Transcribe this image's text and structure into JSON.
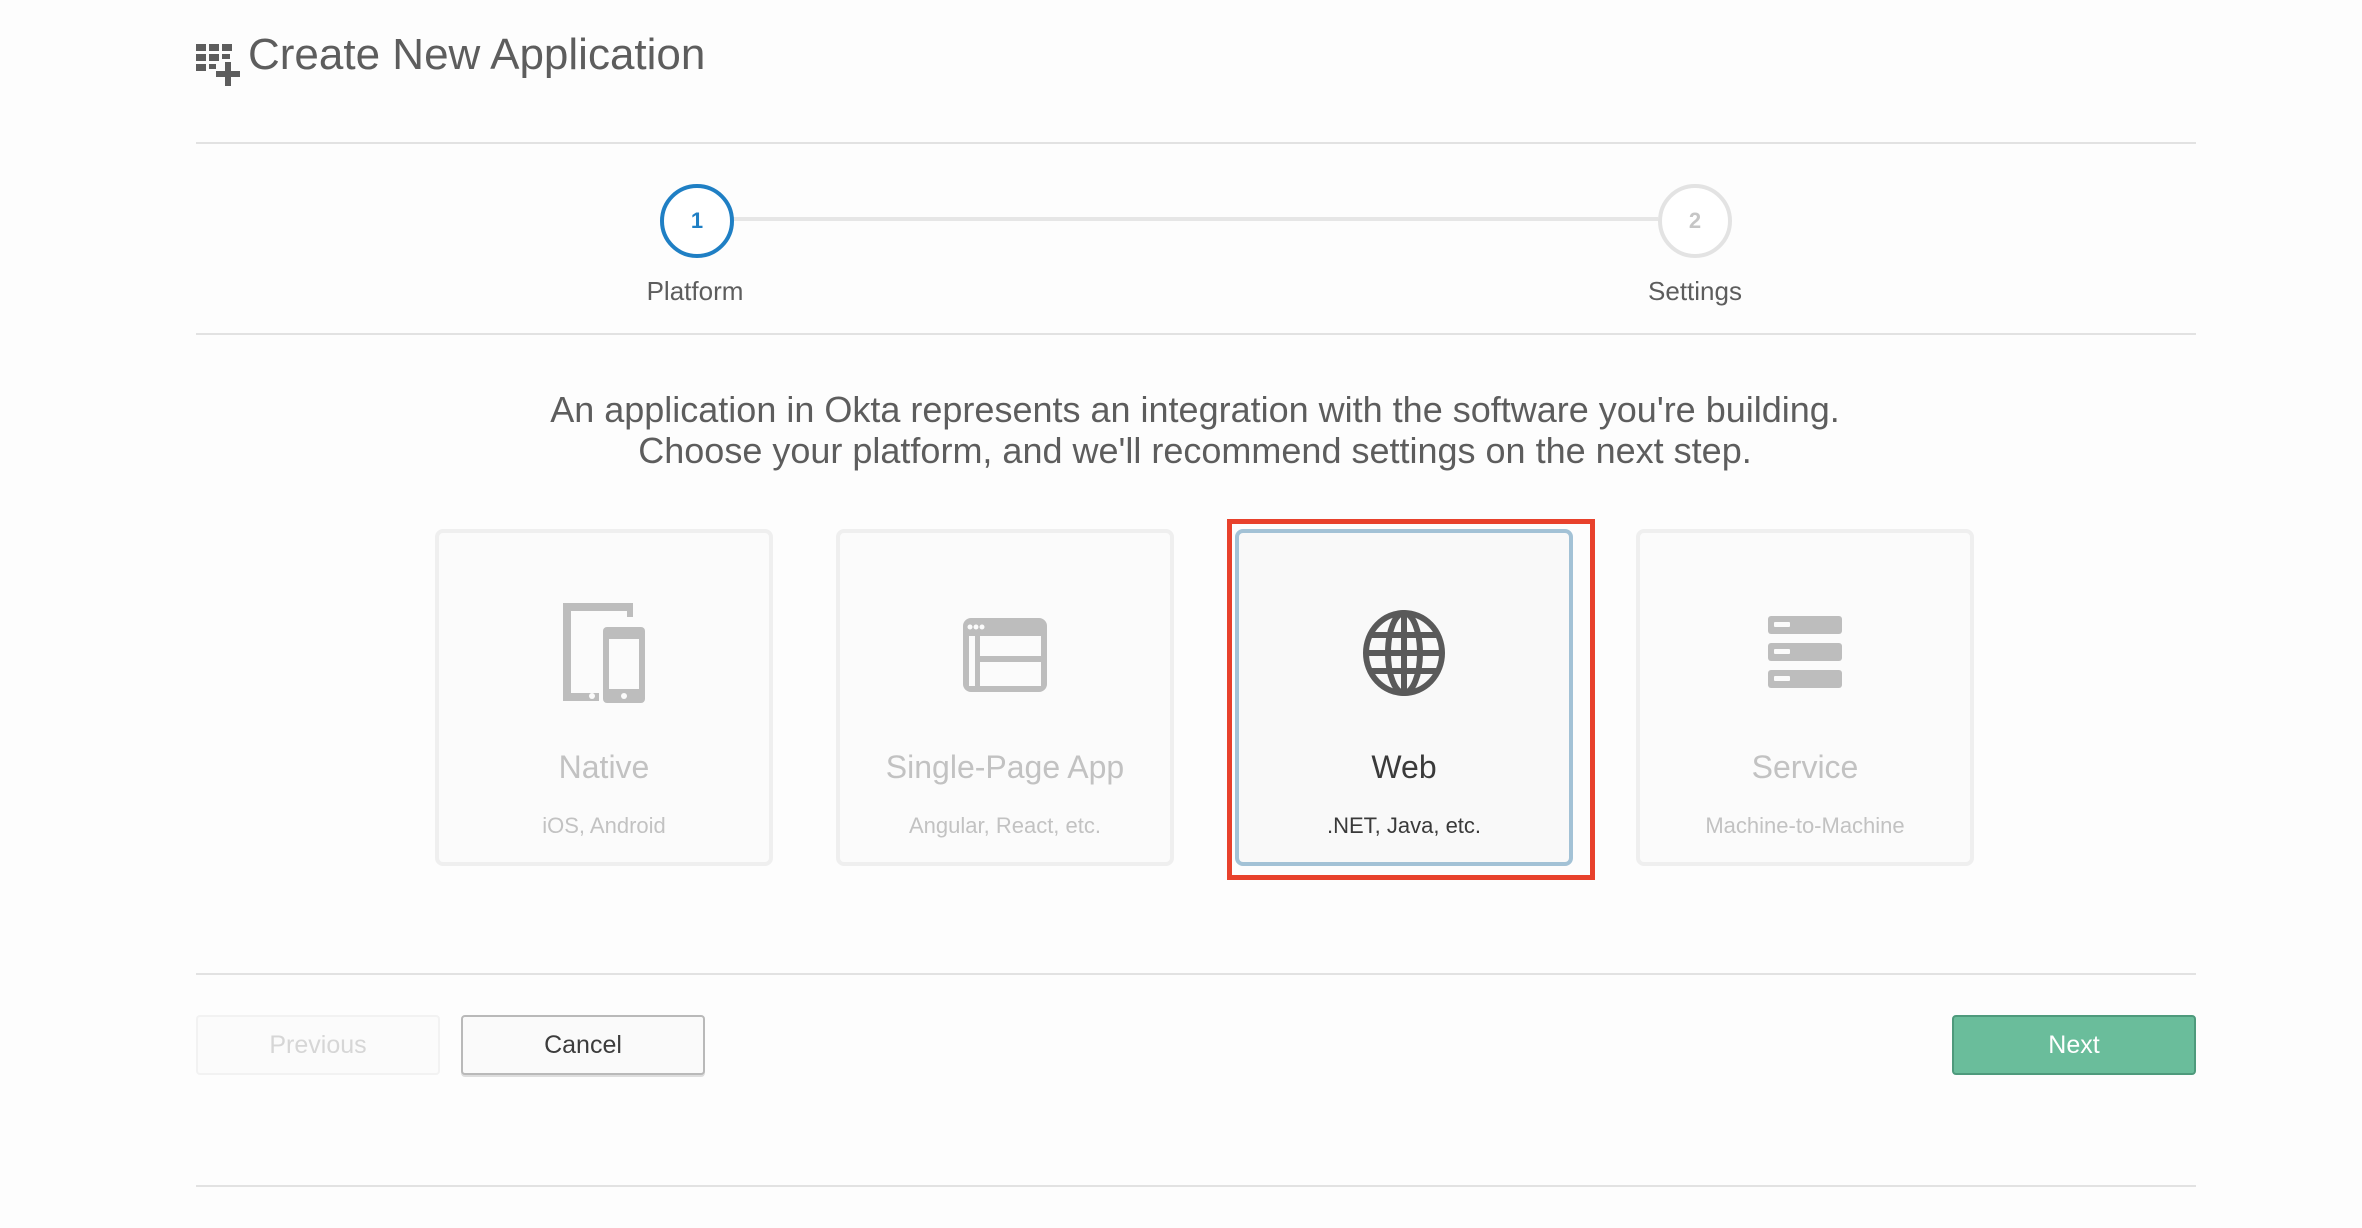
{
  "header": {
    "title": "Create New Application",
    "icon": "grid-plus-icon"
  },
  "stepper": {
    "steps": [
      {
        "number": "1",
        "label": "Platform",
        "active": true
      },
      {
        "number": "2",
        "label": "Settings",
        "active": false
      }
    ],
    "active_color": "#1f7fc4"
  },
  "description": {
    "line1": "An application in Okta represents an integration with the software you're building.",
    "line2": "Choose your platform, and we'll recommend settings on the next step."
  },
  "platforms": [
    {
      "name": "Native",
      "subtitle": "iOS, Android",
      "icon": "mobile-devices-icon",
      "selected": false
    },
    {
      "name": "Single-Page App",
      "subtitle": "Angular, React, etc.",
      "icon": "browser-layout-icon",
      "selected": false
    },
    {
      "name": "Web",
      "subtitle": ".NET, Java, etc.",
      "icon": "globe-icon",
      "selected": true
    },
    {
      "name": "Service",
      "subtitle": "Machine-to-Machine",
      "icon": "server-stack-icon",
      "selected": false
    }
  ],
  "footer": {
    "previous_label": "Previous",
    "cancel_label": "Cancel",
    "next_label": "Next",
    "next_color": "#6abd9b"
  },
  "highlight_color": "#e8412c"
}
